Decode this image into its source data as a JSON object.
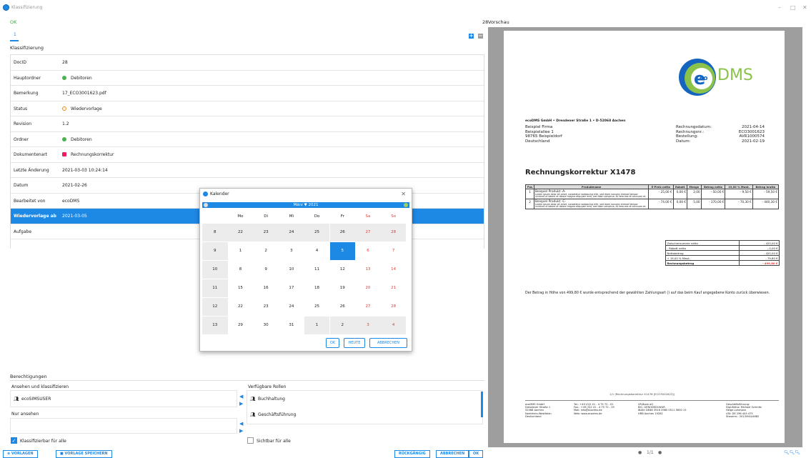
{
  "window": {
    "title": "Klassifizierung",
    "minimize": "–",
    "maximize": "□",
    "close": "✕"
  },
  "ok_link": "OK",
  "docid_top": "28",
  "preview_label": "Vorschau",
  "tab": "1",
  "section": "Klassifizierung",
  "fields": [
    {
      "label": "DocID",
      "value": "28"
    },
    {
      "label": "Hauptordner",
      "value": "Debitoren",
      "icon": "green"
    },
    {
      "label": "Bemerkung",
      "value": "17_ECO3001623.pdf"
    },
    {
      "label": "Status",
      "value": "Wiedervorlage",
      "icon": "orange"
    },
    {
      "label": "Revision",
      "value": "1.2"
    },
    {
      "label": "Ordner",
      "value": "Debitoren",
      "icon": "green"
    },
    {
      "label": "Dokumentenart",
      "value": "Rechnungskorrektur",
      "icon": "pink"
    },
    {
      "label": "Letzte Änderung",
      "value": "2021-03-03 10:24:14"
    },
    {
      "label": "Datum",
      "value": "2021-02-26"
    },
    {
      "label": "Bearbeitet von",
      "value": "ecoDMS"
    },
    {
      "label": "Wiedervorlage ab",
      "value": "2021-03-05",
      "selected": true
    },
    {
      "label": "Aufgabe",
      "value": ""
    }
  ],
  "calendar": {
    "title": "Kalender",
    "close": "✕",
    "header": "März ▼ 2021",
    "weekdays": [
      "Mo",
      "Di",
      "Mi",
      "Do",
      "Fr",
      "Sa",
      "So"
    ],
    "weeks": [
      {
        "kw": "8",
        "days": [
          "22",
          "23",
          "24",
          "25",
          "26",
          "27",
          "28"
        ]
      },
      {
        "kw": "9",
        "days": [
          "1",
          "2",
          "3",
          "4",
          "5",
          "6",
          "7"
        ]
      },
      {
        "kw": "10",
        "days": [
          "8",
          "9",
          "10",
          "11",
          "12",
          "13",
          "14"
        ]
      },
      {
        "kw": "11",
        "days": [
          "15",
          "16",
          "17",
          "18",
          "19",
          "20",
          "21"
        ]
      },
      {
        "kw": "12",
        "days": [
          "22",
          "23",
          "24",
          "25",
          "26",
          "27",
          "28"
        ]
      },
      {
        "kw": "13",
        "days": [
          "29",
          "30",
          "31",
          "1",
          "2",
          "3",
          "4"
        ]
      }
    ],
    "selected_day": "5",
    "ok": "OK",
    "heute": "HEUTE",
    "abbrechen": "ABBRECHEN"
  },
  "permissions": {
    "title": "Berechtigungen",
    "view_classify": "Ansehen und klassifizieren",
    "available_roles": "Verfügbare Rollen",
    "user": "ecoSIMSUSER",
    "roles": [
      "Buchhaltung",
      "Geschäftsführung"
    ],
    "view_only": "Nur ansehen",
    "classifiable_all": "Klassifizierbar für alle",
    "visible_all": "Sichtbar für alle"
  },
  "buttons": {
    "vorlagen": "⊕ VORLAGEN",
    "vorlage_speichern": "VORLAGE SPEICHERN",
    "rueckgaengig": "RÜCKGÄNGIG",
    "abbrechen": "ABBRECHEN",
    "ok": "OK"
  },
  "preview": {
    "page": "1/1",
    "logo_e": "e",
    "logo_co": "co",
    "logo_dms": "DMS",
    "sender_line": "ecoDMS GmbH • Dresdener Straße 1 • D-52068 Aachen",
    "recipient": [
      "Beispiel Firma",
      "Beispielallee 1",
      "98765 Beispieldorf",
      "Deutschland"
    ],
    "meta_labels": [
      "Rechnungsdatum:",
      "Rechnungsnr.:",
      "Bestellung:",
      "Datum:"
    ],
    "meta_values": [
      "2021-04-14",
      "ECO3001623",
      "AVR1000574",
      "2021-02-19"
    ],
    "heading": "Rechnungskorrektur X1478",
    "table_headers": [
      "Pos",
      "Produktname",
      "E-Preis netto",
      "Rabatt",
      "Menge",
      "Betrag netto",
      "19,00 % Mwst.",
      "Betrag brutto"
    ],
    "rows": [
      {
        "pos": "1",
        "name": "Beispiel Produkt -A-",
        "desc": "Lorem ipsum dolor sit amet, consetetur sadipscing elitr, sed diam nonumy eirmod tempor invidunt ut labore et dolore magna aliquyam erat, sed diam voluptua. At vero eos et accusam et.",
        "preis": "- 25,00 €",
        "rabatt": "0,00 €",
        "menge": "2,00",
        "netto": "- 50,00 €",
        "mwst": "- 9,50 €",
        "brutto": "- 59,50 €"
      },
      {
        "pos": "2",
        "name": "Beispiel Produkt -C-",
        "desc": "Lorem ipsum dolor sit amet, consetetur sadipscing elitr, sed diam nonumy eirmod tempor invidunt ut labore et dolore magna aliquyam erat, sed diam voluptua. At vero eos et accusam et.",
        "preis": "- 74,00 €",
        "rabatt": "0,00 €",
        "menge": "5,00",
        "netto": "- 370,00 €",
        "mwst": "- 70,30 €",
        "brutto": "- 440,30 €"
      }
    ],
    "sums": [
      {
        "label": "Zwischensumme netto",
        "value": "- 420,00 €"
      },
      {
        "label": "- Rabatt netto",
        "value": "- 0,00 €"
      },
      {
        "label": "Nettobetrag",
        "value": "- 420,00 €"
      },
      {
        "label": "+ 19,00 % Mwst.",
        "value": "- 79,80 €"
      },
      {
        "label": "Rechnungsbetrag",
        "value": "- 499,80 €"
      }
    ],
    "note": "Der Betrag in Höhe von 499,80 € wurde entsprechend der gewählten Zahlungsart () auf das beim Kauf angegebene Konto zurück überwiesen.",
    "footer_page": "1/1 (Rechnungskorrektur X1478 [ECO3001623])",
    "footer_cols": [
      "ecoDMS GmbH\nDresdener Straße 1\n52068 Aachen\nNordrhein-Westfalen\nDeutschland",
      "Tel.: +49 (0)2 41 - 4 75 72 - 01\nFax.: +49 (0)2 41 - 4 75 72 - 29\nMail: info@ecodms.de\nWeb: www.ecodms.de",
      "VR-Bank eG\nBIC: GENODED1WUR\nIBAN: DE88 3916 2980 0511 5850 15\nHRB Aachen 19281",
      "Geschäftsführung:\nDipl-Betrw. Michael Schmitz\nHelge Lohmann\nUSt: DE 296 443 475\nSteuernr.: 201/5944/4682"
    ],
    "zoom_icons": "🔍︎🔍︎🔍︎"
  }
}
